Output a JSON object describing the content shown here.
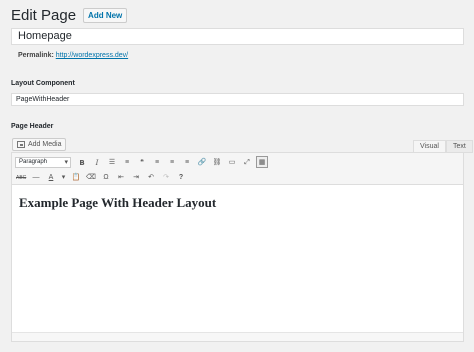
{
  "header": {
    "title": "Edit Page",
    "add_new": "Add New"
  },
  "post": {
    "title": "Homepage"
  },
  "permalink": {
    "label": "Permalink:",
    "url": "http://wordexpress.dev/"
  },
  "layout": {
    "label": "Layout Component",
    "value": "PageWithHeader"
  },
  "page_header": {
    "label": "Page Header",
    "add_media": "Add Media",
    "tabs": [
      {
        "label": "Visual",
        "active": true
      },
      {
        "label": "Text",
        "active": false
      }
    ],
    "toolbar": {
      "format_select": "Paragraph",
      "row1": [
        {
          "name": "bold-icon",
          "glyph": "B"
        },
        {
          "name": "italic-icon",
          "glyph": "I"
        },
        {
          "name": "bullet-list-icon",
          "glyph": "☰"
        },
        {
          "name": "numbered-list-icon",
          "glyph": "≡"
        },
        {
          "name": "blockquote-icon",
          "glyph": "❝"
        },
        {
          "name": "align-left-icon",
          "glyph": "≡"
        },
        {
          "name": "align-center-icon",
          "glyph": "≡"
        },
        {
          "name": "align-right-icon",
          "glyph": "≡"
        },
        {
          "name": "link-icon",
          "glyph": "🔗"
        },
        {
          "name": "unlink-icon",
          "glyph": "⛓"
        },
        {
          "name": "read-more-icon",
          "glyph": "▭"
        },
        {
          "name": "fullscreen-icon",
          "glyph": "⤢"
        },
        {
          "name": "toolbar-toggle-icon",
          "glyph": "▦"
        }
      ],
      "row2": [
        {
          "name": "strikethrough-icon",
          "glyph": "ABC"
        },
        {
          "name": "horizontal-line-icon",
          "glyph": "—"
        },
        {
          "name": "text-color-icon",
          "glyph": "A"
        },
        {
          "name": "text-color-dropdown-icon",
          "glyph": "▾"
        },
        {
          "name": "paste-as-text-icon",
          "glyph": "📋"
        },
        {
          "name": "clear-formatting-icon",
          "glyph": "⌫"
        },
        {
          "name": "special-character-icon",
          "glyph": "Ω"
        },
        {
          "name": "outdent-icon",
          "glyph": "⇤"
        },
        {
          "name": "indent-icon",
          "glyph": "⇥"
        },
        {
          "name": "undo-icon",
          "glyph": "↶"
        },
        {
          "name": "redo-icon",
          "glyph": "↷"
        },
        {
          "name": "help-icon",
          "glyph": "?"
        }
      ]
    },
    "content_heading": "Example Page With Header Layout"
  }
}
